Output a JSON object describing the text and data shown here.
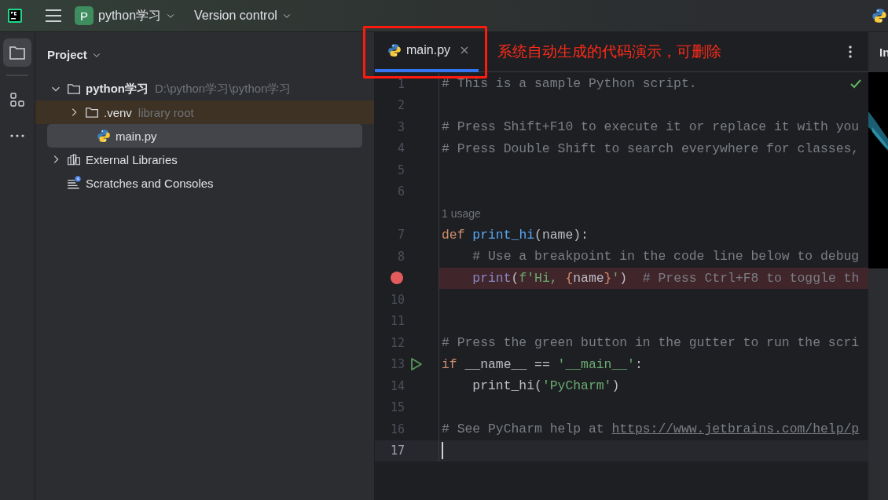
{
  "top_bar": {
    "project_badge": "P",
    "project_name": "python学习",
    "vcs": "Version control"
  },
  "tool_strip": [
    {
      "kind": "folder",
      "selected": true
    },
    {
      "kind": "structure",
      "selected": false
    },
    {
      "kind": "more",
      "selected": false
    }
  ],
  "project_panel": {
    "title": "Project",
    "tree": [
      {
        "label": "python学习",
        "hint": "D:\\python学习\\python学习",
        "kind": "folder",
        "expanded": true,
        "selected": false,
        "library": false,
        "children": [
          {
            "label": ".venv",
            "hint": "library root",
            "kind": "folder",
            "expanded": false,
            "selected": false,
            "library": true
          },
          {
            "label": "main.py",
            "kind": "python",
            "selected": true,
            "library": false
          }
        ]
      },
      {
        "label": "External Libraries",
        "kind": "library",
        "expanded": false,
        "selected": false,
        "library": false
      },
      {
        "label": "Scratches and Consoles",
        "kind": "scratches",
        "selected": false,
        "library": false
      }
    ]
  },
  "editor": {
    "tabs": [
      {
        "label": "main.py",
        "selected": true
      }
    ],
    "annotation": "系统自动生成的代码演示，可删除",
    "lines": [
      {
        "kind": "code",
        "number": "1",
        "tokens": [
          {
            "kind": "comment",
            "text": "# This is a sample Python script."
          }
        ]
      },
      {
        "kind": "code",
        "number": "2"
      },
      {
        "kind": "code",
        "number": "3",
        "tokens": [
          {
            "kind": "comment",
            "text": "# Press Shift+F10 to execute it or replace it with you"
          }
        ]
      },
      {
        "kind": "code",
        "number": "4",
        "tokens": [
          {
            "kind": "comment",
            "text": "# Press Double Shift to search everywhere for classes,"
          }
        ]
      },
      {
        "kind": "code",
        "number": "5"
      },
      {
        "kind": "code",
        "number": "6"
      },
      {
        "kind": "hint",
        "text": "1 usage"
      },
      {
        "kind": "code",
        "number": "7",
        "tokens": [
          {
            "kind": "keyword",
            "text": "def "
          },
          {
            "kind": "function",
            "text": "print_hi"
          },
          {
            "kind": "plain",
            "text": "(name):"
          }
        ]
      },
      {
        "kind": "code",
        "number": "8",
        "tokens": [
          {
            "kind": "comment",
            "text": "    # Use a breakpoint in the code line below to debug"
          }
        ]
      },
      {
        "kind": "code",
        "breakpoint": true,
        "tokens": [
          {
            "kind": "builtin",
            "text": "    print"
          },
          {
            "kind": "plain",
            "text": "("
          },
          {
            "kind": "string",
            "text": "f'Hi, "
          },
          {
            "kind": "brace",
            "text": "{"
          },
          {
            "kind": "plain",
            "text": "name"
          },
          {
            "kind": "brace",
            "text": "}"
          },
          {
            "kind": "string",
            "text": "'"
          },
          {
            "kind": "plain",
            "text": ")"
          },
          {
            "kind": "comment",
            "text": "  # Press Ctrl+F8 to toggle th"
          }
        ]
      },
      {
        "kind": "code",
        "number": "10"
      },
      {
        "kind": "code",
        "number": "11"
      },
      {
        "kind": "code",
        "number": "12",
        "tokens": [
          {
            "kind": "comment",
            "text": "# Press the green button in the gutter to run the scri"
          }
        ]
      },
      {
        "kind": "code",
        "number": "13",
        "run": true,
        "tokens": [
          {
            "kind": "keyword",
            "text": "if"
          },
          {
            "kind": "plain",
            "text": " __name__ == "
          },
          {
            "kind": "string",
            "text": "'__main__'"
          },
          {
            "kind": "plain",
            "text": ":"
          }
        ]
      },
      {
        "kind": "code",
        "number": "14",
        "tokens": [
          {
            "kind": "plain",
            "text": "    print_hi("
          },
          {
            "kind": "string",
            "text": "'PyCharm'"
          },
          {
            "kind": "plain",
            "text": ")"
          }
        ]
      },
      {
        "kind": "code",
        "number": "15"
      },
      {
        "kind": "code",
        "number": "16",
        "tokens": [
          {
            "kind": "comment",
            "text": "# See PyCharm help at "
          },
          {
            "kind": "link",
            "text": "https://www.jetbrains.com/help/p"
          }
        ]
      },
      {
        "kind": "code",
        "number": "17",
        "current": true
      }
    ]
  },
  "right_panel": {
    "title": "In"
  }
}
